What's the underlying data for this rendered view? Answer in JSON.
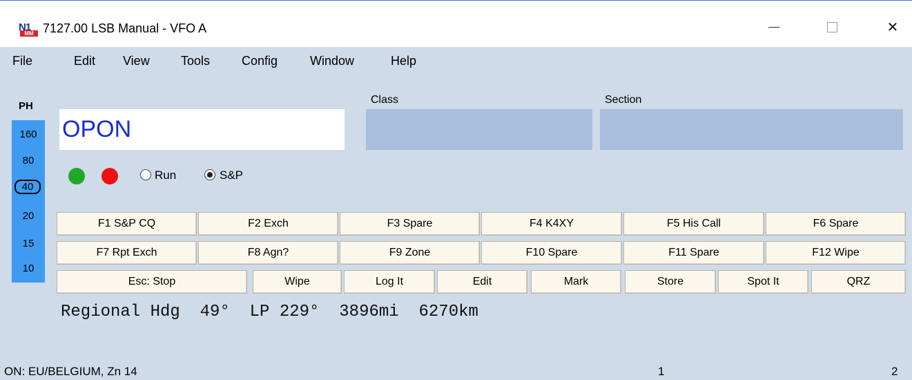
{
  "window": {
    "title": "7127.00 LSB Manual - VFO A",
    "icon_top": "N1",
    "icon_bottom": "MM",
    "minimize": "minimize",
    "maximize": "maximize",
    "close": "✕"
  },
  "menu": [
    "File",
    "Edit",
    "View",
    "Tools",
    "Config",
    "Window",
    "Help"
  ],
  "mode": "PH",
  "bands": [
    "160",
    "80",
    "40",
    "20",
    "15",
    "10"
  ],
  "selected_band": "40",
  "entry": {
    "call": "OPON",
    "class_label": "Class",
    "class_value": "",
    "section_label": "Section",
    "section_value": ""
  },
  "radio": {
    "run_label": "Run",
    "sp_label": "S&P",
    "selected": "S&P"
  },
  "fkeys_row1": [
    "F1 S&P CQ",
    "F2 Exch",
    "F3 Spare",
    "F4 K4XY",
    "F5 His Call",
    "F6 Spare"
  ],
  "fkeys_row2": [
    "F7 Rpt Exch",
    "F8 Agn?",
    "F9 Zone",
    "F10 Spare",
    "F11 Spare",
    "F12 Wipe"
  ],
  "buttons_row3": [
    "Esc: Stop",
    "Wipe",
    "Log It",
    "Edit",
    "Mark",
    "Store",
    "Spot It",
    "QRZ"
  ],
  "bearing": {
    "text": "Regional Hdg  49°  LP 229°  3896mi  6270km"
  },
  "status": {
    "left": "ON: EU/BELGIUM, Zn 14",
    "mid": "1",
    "right": "2"
  }
}
